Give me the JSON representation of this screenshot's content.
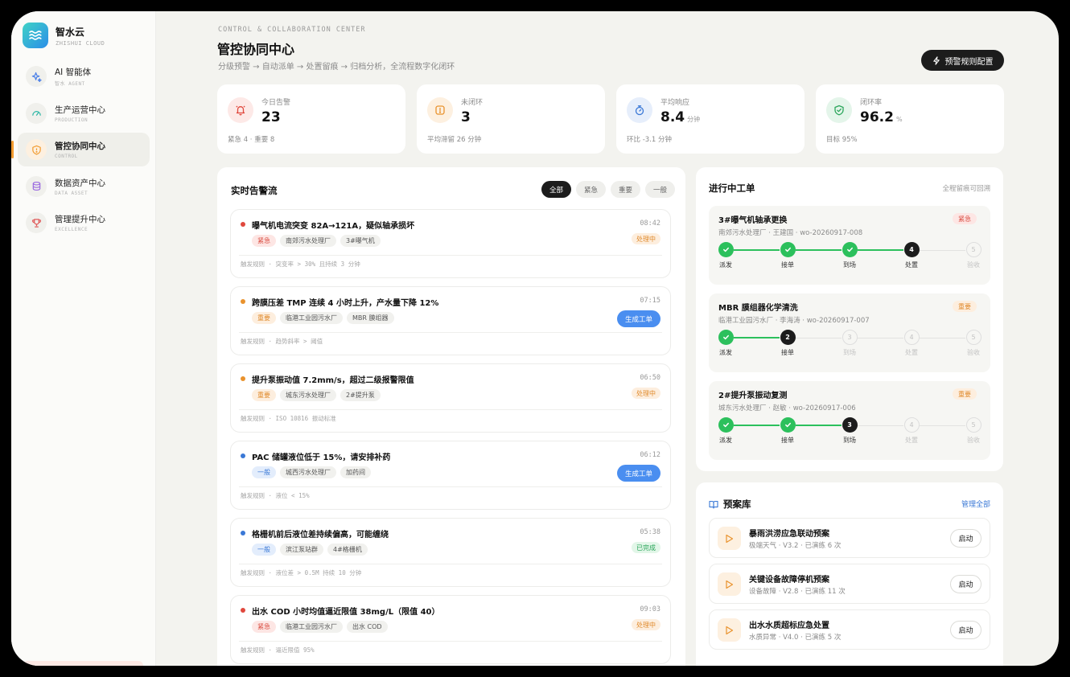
{
  "brand": {
    "name": "智水云",
    "subtitle": "ZHISHUI CLOUD"
  },
  "nav": [
    {
      "title": "AI 智能体",
      "subtitle": "智水 AGENT",
      "icon": "sparkle-icon",
      "color": "#4a7fe8",
      "active": false
    },
    {
      "title": "生产运营中心",
      "subtitle": "PRODUCTION",
      "icon": "gauge-icon",
      "color": "#2fb7a6",
      "active": false
    },
    {
      "title": "管控协同中心",
      "subtitle": "CONTROL",
      "icon": "shield-alert-icon",
      "color": "#f29b2f",
      "active": true
    },
    {
      "title": "数据资产中心",
      "subtitle": "DATA ASSET",
      "icon": "database-icon",
      "color": "#9b6be0",
      "active": false
    },
    {
      "title": "管理提升中心",
      "subtitle": "EXCELLENCE",
      "icon": "trophy-icon",
      "color": "#e05a5a",
      "active": false
    }
  ],
  "header": {
    "kicker": "CONTROL & COLLABORATION CENTER",
    "title": "管控协同中心",
    "subtitle": "分级预警 → 自动派单 → 处置留痕 → 归档分析，全流程数字化闭环",
    "action_label": "预警规则配置"
  },
  "kpis": [
    {
      "label": "今日告警",
      "value": "23",
      "unit": "",
      "foot": "紧急 4 · 重要 8",
      "icon": "bell-icon",
      "color": "#e0483d",
      "bg": "#fde9e7"
    },
    {
      "label": "未闭环",
      "value": "3",
      "unit": "",
      "foot": "平均滞留 26 分钟",
      "icon": "alert-box-icon",
      "color": "#e9922d",
      "bg": "#fdf0e0"
    },
    {
      "label": "平均响应",
      "value": "8.4",
      "unit": "分钟",
      "foot": "环比 -3.1 分钟",
      "icon": "stopwatch-icon",
      "color": "#3a78d6",
      "bg": "#e6eefb"
    },
    {
      "label": "闭环率",
      "value": "96.2",
      "unit": "%",
      "foot": "目标 95%",
      "icon": "shield-check-icon",
      "color": "#2aa55a",
      "bg": "#e4f5ea"
    }
  ],
  "alerts_panel": {
    "title": "实时告警流",
    "filters": [
      "全部",
      "紧急",
      "重要",
      "一般"
    ],
    "active_filter": 0,
    "items": [
      {
        "title": "曝气机电流突变 82A→121A，疑似轴承损坏",
        "level": "紧急",
        "level_class": "red",
        "dot": "#e0483d",
        "site": "南郊污水处理厂",
        "asset": "3#曝气机",
        "time": "08:42",
        "status": "处理中",
        "action": "",
        "rule": "触发规则 · 突变率 > 30% 且持续 3 分钟"
      },
      {
        "title": "跨膜压差 TMP 连续 4 小时上升，产水量下降 12%",
        "level": "重要",
        "level_class": "orange",
        "dot": "#e9922d",
        "site": "临港工业园污水厂",
        "asset": "MBR 膜组器",
        "time": "07:15",
        "status": "",
        "action": "生成工单",
        "rule": "触发规则 · 趋势斜率 > 阈值"
      },
      {
        "title": "提升泵振动值 7.2mm/s，超过二级报警限值",
        "level": "重要",
        "level_class": "orange",
        "dot": "#e9922d",
        "site": "城东污水处理厂",
        "asset": "2#提升泵",
        "time": "06:50",
        "status": "处理中",
        "action": "",
        "rule": "触发规则 · ISO 10816 振动标准"
      },
      {
        "title": "PAC 储罐液位低于 15%，请安排补药",
        "level": "一般",
        "level_class": "blue",
        "dot": "#3a78d6",
        "site": "城西污水处理厂",
        "asset": "加药间",
        "time": "06:12",
        "status": "",
        "action": "生成工单",
        "rule": "触发规则 · 液位 < 15%"
      },
      {
        "title": "格栅机前后液位差持续偏高，可能缠绕",
        "level": "一般",
        "level_class": "blue",
        "dot": "#3a78d6",
        "site": "滨江泵站群",
        "asset": "4#格栅机",
        "time": "05:38",
        "status": "已完成",
        "action": "",
        "rule": "触发规则 · 液位差 > 0.5M 持续 10 分钟"
      },
      {
        "title": "出水 COD 小时均值逼近限值 38mg/L（限值 40）",
        "level": "紧急",
        "level_class": "red",
        "dot": "#e0483d",
        "site": "临港工业园污水厂",
        "asset": "出水 COD",
        "time": "09:03",
        "status": "处理中",
        "action": "",
        "rule": "触发规则 · 逼近限值 95%"
      }
    ]
  },
  "orders_panel": {
    "title": "进行中工单",
    "note": "全程留痕可回溯",
    "step_names": [
      "派发",
      "接单",
      "到场",
      "处置",
      "验收"
    ],
    "items": [
      {
        "title": "3#曝气机轴承更换",
        "meta": "南郊污水处理厂 · 王建国 · wo-20260917-008",
        "badge": "紧急",
        "badge_class": "red",
        "current_step": 4
      },
      {
        "title": "MBR 膜组器化学清洗",
        "meta": "临港工业园污水厂 · 李海涛 · wo-20260917-007",
        "badge": "重要",
        "badge_class": "orange",
        "current_step": 2
      },
      {
        "title": "2#提升泵振动复测",
        "meta": "城东污水处理厂 · 赵敏 · wo-20260917-006",
        "badge": "重要",
        "badge_class": "orange",
        "current_step": 3
      }
    ]
  },
  "plans_panel": {
    "title": "预案库",
    "manage_label": "管理全部",
    "items": [
      {
        "title": "暴雨洪涝应急联动预案",
        "meta": "极端天气 · V3.2 · 已演练 6 次",
        "action": "启动"
      },
      {
        "title": "关键设备故障停机预案",
        "meta": "设备故障 · V2.8 · 已演练 11 次",
        "action": "启动"
      },
      {
        "title": "出水水质超标应急处置",
        "meta": "水质异常 · V4.0 · 已演练 5 次",
        "action": "启动"
      }
    ]
  }
}
